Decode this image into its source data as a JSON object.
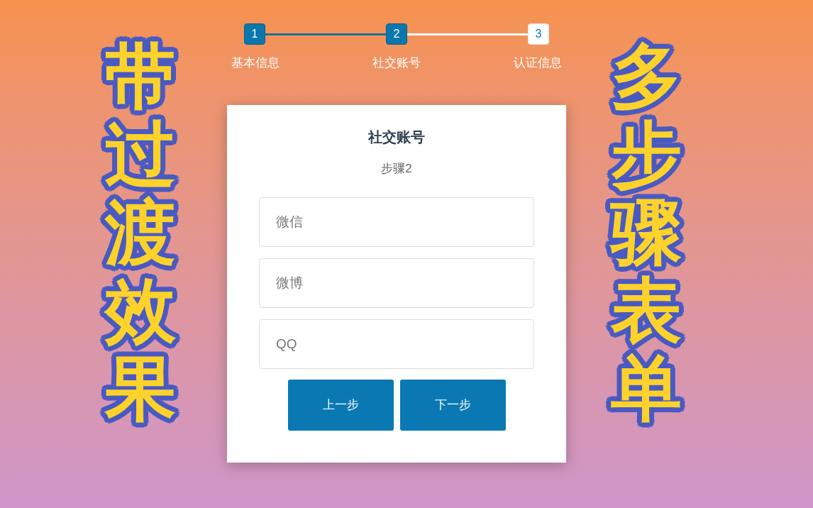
{
  "left_banner": "带过渡效果",
  "steps": [
    {
      "number": "1",
      "label": "基本信息",
      "active": true
    },
    {
      "number": "2",
      "label": "社交账号",
      "active": true
    },
    {
      "number": "3",
      "label": "认证信息",
      "active": false
    }
  ],
  "card": {
    "title": "社交账号",
    "subtitle": "步骤2",
    "fields": [
      {
        "placeholder": "微信"
      },
      {
        "placeholder": "微博"
      },
      {
        "placeholder": "QQ"
      }
    ],
    "buttons": [
      {
        "label": "上一步"
      },
      {
        "label": "下一步"
      }
    ]
  },
  "right_banner": "多步骤表单"
}
